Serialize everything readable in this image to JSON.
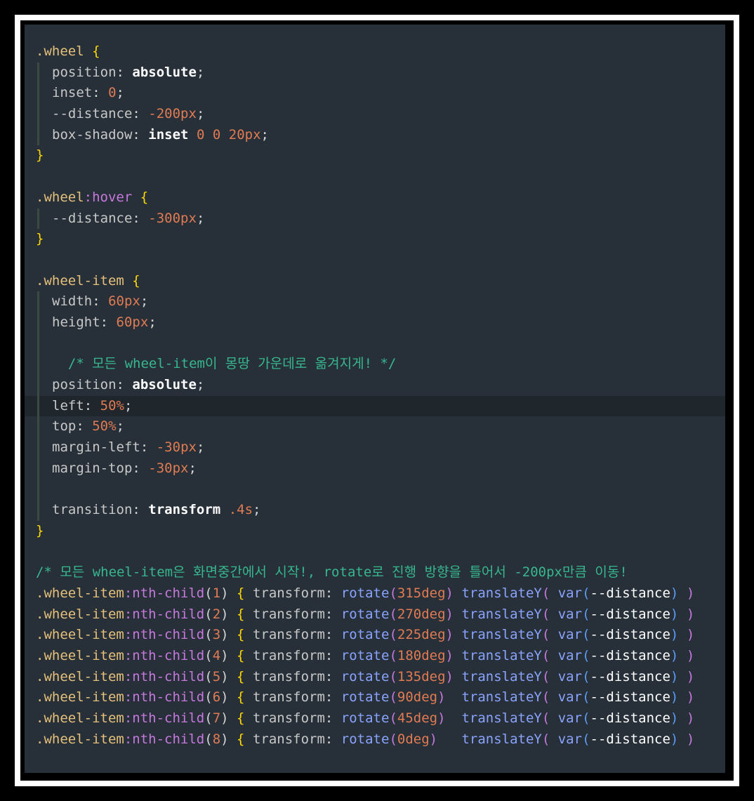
{
  "editor": {
    "theme_background": "#273038",
    "active_line_index": 17,
    "lines": [
      ".wheel {",
      "  position: absolute;",
      "  inset: 0;",
      "  --distance: -200px;",
      "  box-shadow: inset 0 0 20px;",
      "}",
      "",
      ".wheel:hover {",
      "  --distance: -300px;",
      "}",
      "",
      ".wheel-item {",
      "  width: 60px;",
      "  height: 60px;",
      "",
      "  /* 모든 wheel-item이 몽땅 가운데로 옮겨지게! */",
      "  position: absolute;",
      "  left: 50%;",
      "  top: 50%;",
      "  margin-left: -30px;",
      "  margin-top: -30px;",
      "",
      "  transition: transform .4s;",
      "}",
      "",
      "/* 모든 wheel-item은 화면중간에서 시작!, rotate로 진행 방향을 틀어서 -200px만큼 이동!",
      ".wheel-item:nth-child(1) { transform: rotate(315deg) translateY( var(--distance) )",
      ".wheel-item:nth-child(2) { transform: rotate(270deg) translateY( var(--distance) )",
      ".wheel-item:nth-child(3) { transform: rotate(225deg) translateY( var(--distance) )",
      ".wheel-item:nth-child(4) { transform: rotate(180deg) translateY( var(--distance) )",
      ".wheel-item:nth-child(5) { transform: rotate(135deg) translateY( var(--distance) )",
      ".wheel-item:nth-child(6) { transform: rotate(90deg)  translateY( var(--distance) )",
      ".wheel-item:nth-child(7) { transform: rotate(45deg)  translateY( var(--distance) )",
      ".wheel-item:nth-child(8) { transform: rotate(0deg)   translateY( var(--distance) )"
    ]
  }
}
